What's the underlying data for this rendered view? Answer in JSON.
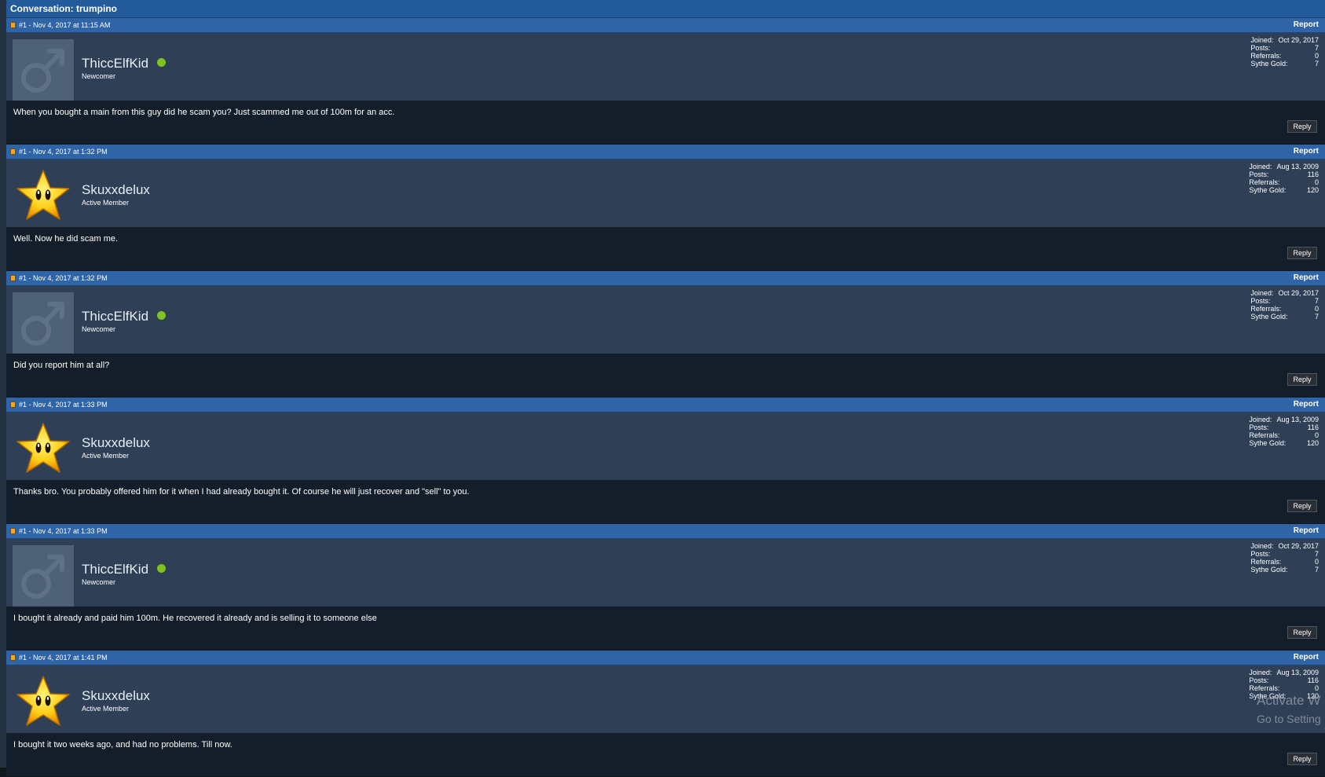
{
  "conversation": {
    "title": "Conversation: trumpino"
  },
  "labels": {
    "report": "Report",
    "reply": "Reply",
    "joined": "Joined:",
    "posts": "Posts:",
    "referrals": "Referrals:",
    "gold": "Sythe Gold:"
  },
  "posts": [
    {
      "meta": "#1 - Nov 4, 2017 at 11:15 AM",
      "username": "ThiccElfKid",
      "online": true,
      "rank": "Newcomer",
      "avatar": "default-male-avatar",
      "joined": "Oct 29, 2017",
      "posts": "7",
      "referrals": "0",
      "gold": "7",
      "text": "When you bought a main from this guy did he scam you? Just scammed me out of 100m for an acc."
    },
    {
      "meta": "#1 - Nov 4, 2017 at 1:32 PM",
      "username": "Skuxxdelux",
      "online": false,
      "rank": "Active Member",
      "avatar": "star-avatar",
      "joined": "Aug 13, 2009",
      "posts": "116",
      "referrals": "0",
      "gold": "120",
      "text": "Well. Now he did scam me."
    },
    {
      "meta": "#1 - Nov 4, 2017 at 1:32 PM",
      "username": "ThiccElfKid",
      "online": true,
      "rank": "Newcomer",
      "avatar": "default-male-avatar",
      "joined": "Oct 29, 2017",
      "posts": "7",
      "referrals": "0",
      "gold": "7",
      "text": "Did you report him at all?"
    },
    {
      "meta": "#1 - Nov 4, 2017 at 1:33 PM",
      "username": "Skuxxdelux",
      "online": false,
      "rank": "Active Member",
      "avatar": "star-avatar",
      "joined": "Aug 13, 2009",
      "posts": "116",
      "referrals": "0",
      "gold": "120",
      "text": "Thanks bro. You probably offered him for it when I had already bought it. Of course he will just recover and \"sell\" to you."
    },
    {
      "meta": "#1 - Nov 4, 2017 at 1:33 PM",
      "username": "ThiccElfKid",
      "online": true,
      "rank": "Newcomer",
      "avatar": "default-male-avatar",
      "joined": "Oct 29, 2017",
      "posts": "7",
      "referrals": "0",
      "gold": "7",
      "text": "I bought it already and paid him 100m. He recovered it already and is selling it to someone else"
    },
    {
      "meta": "#1 - Nov 4, 2017 at 1:41 PM",
      "username": "Skuxxdelux",
      "online": false,
      "rank": "Active Member",
      "avatar": "star-avatar",
      "joined": "Aug 13, 2009",
      "posts": "116",
      "referrals": "0",
      "gold": "120",
      "text": "I bought it two weeks ago, and had no problems. Till now."
    }
  ],
  "watermark": {
    "line1": "Activate W",
    "line2": "Go to Setting"
  },
  "colors": {
    "header": "#245c9b",
    "post_header": "#2f64a6",
    "user_panel": "#2e3f56",
    "body": "#141e2b",
    "online": "#7ec31f"
  }
}
